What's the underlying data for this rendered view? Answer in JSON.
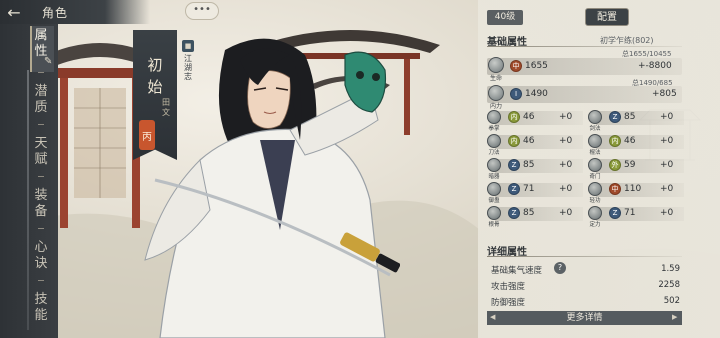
{
  "header": {
    "back_icon": "back-arrow-icon",
    "title": "角色",
    "chat_bubble": "•••"
  },
  "menu": {
    "items": [
      {
        "label": "属性",
        "active": true
      },
      {
        "label": "潜质",
        "active": false
      },
      {
        "label": "天赋",
        "active": false
      },
      {
        "label": "装备",
        "active": false
      },
      {
        "label": "心诀",
        "active": false
      },
      {
        "label": "技能",
        "active": false
      }
    ]
  },
  "character": {
    "name": "初始",
    "class": "田文",
    "grade": "丙",
    "sect": "江湖志"
  },
  "panel": {
    "level": "40级",
    "config_label": "配置",
    "basic_title": "基础属性",
    "rank": "初学乍练(802)",
    "hp": {
      "label": "生命",
      "badge": "中",
      "value": "1655",
      "note": "总1655/10455",
      "delta": "+-8800"
    },
    "mp": {
      "label": "内力",
      "badge": "I",
      "value": "1490",
      "note": "总1490/685",
      "delta": "+805"
    },
    "stats": [
      {
        "label": "拳掌",
        "badge": "内",
        "value": "46",
        "delta": "+0"
      },
      {
        "label": "剑法",
        "badge": "Z",
        "value": "85",
        "delta": "+0"
      },
      {
        "label": "刀法",
        "badge": "内",
        "value": "46",
        "delta": "+0"
      },
      {
        "label": "棍法",
        "badge": "内",
        "value": "46",
        "delta": "+0"
      },
      {
        "label": "暗器",
        "badge": "Z",
        "value": "85",
        "delta": "+0"
      },
      {
        "label": "奇门",
        "badge": "外",
        "value": "59",
        "delta": "+0"
      },
      {
        "label": "御蛊",
        "badge": "Z",
        "value": "71",
        "delta": "+0"
      },
      {
        "label": "轻功",
        "badge": "中",
        "value": "110",
        "delta": "+0"
      },
      {
        "label": "根骨",
        "badge": "Z",
        "value": "85",
        "delta": "+0"
      },
      {
        "label": "定力",
        "badge": "Z",
        "value": "71",
        "delta": "+0"
      }
    ],
    "detail_title": "详细属性",
    "details": [
      {
        "label": "基础集气速度",
        "value": "1.59"
      },
      {
        "label": "攻击强度",
        "value": "2258"
      },
      {
        "label": "防御强度",
        "value": "502"
      }
    ],
    "help_icon": "?",
    "more_label": "更多详情"
  },
  "colors": {
    "panel_bg": "#eae7dd",
    "menu_bg": "#2e3236",
    "grade_badge": "#c8562e",
    "badge_inner": "#8a9a3a",
    "badge_z": "#3e5a7a",
    "badge_mid": "#a04a2a"
  }
}
